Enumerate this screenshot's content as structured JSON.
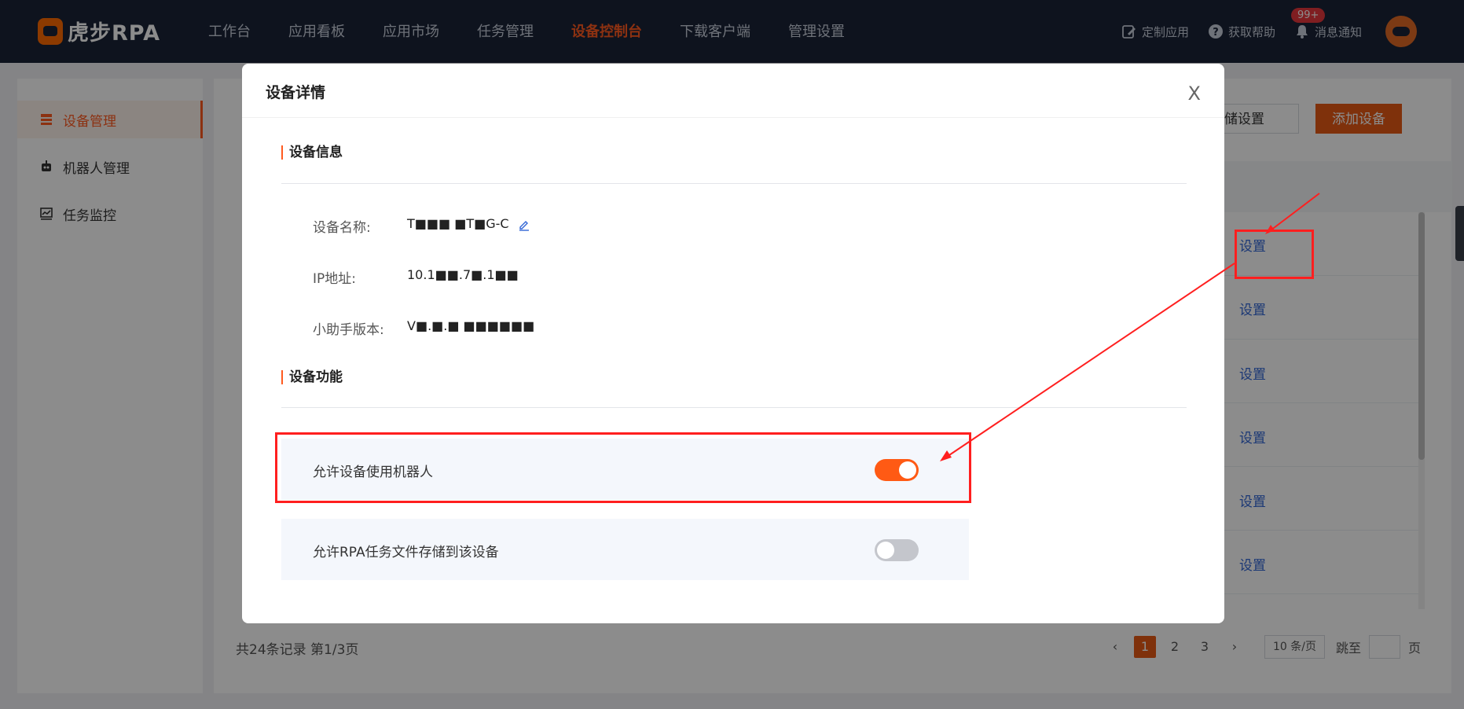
{
  "brand": {
    "name": "虎步RPA"
  },
  "nav": {
    "items": [
      "工作台",
      "应用看板",
      "应用市场",
      "任务管理",
      "设备控制台",
      "下载客户端",
      "管理设置"
    ],
    "active": "设备控制台"
  },
  "tools": {
    "custom_app": "定制应用",
    "help": "获取帮助",
    "notify": "消息通知",
    "notify_badge": "99+"
  },
  "sidebar": {
    "items": [
      {
        "label": "设备管理",
        "icon": "device-list-icon",
        "active": true
      },
      {
        "label": "机器人管理",
        "icon": "robot-icon",
        "active": false
      },
      {
        "label": "任务监控",
        "icon": "monitor-chart-icon",
        "active": false
      }
    ]
  },
  "main": {
    "storage_button": "件存储设置",
    "add_button": "添加设备",
    "row_action": "设置",
    "row_count": 6
  },
  "pagination": {
    "total_text": "共24条记录 第1/3页",
    "pages": [
      "1",
      "2",
      "3"
    ],
    "current": "1",
    "page_size": "10 条/页",
    "jump_label": "跳至",
    "page_unit": "页"
  },
  "modal": {
    "title": "设备详情",
    "close": "X",
    "info_section": "设备信息",
    "fields": [
      {
        "label": "设备名称:",
        "value": "T■■■ ■T■G-C"
      },
      {
        "label": "IP地址:",
        "value": "10.1■■.7■.1■■"
      },
      {
        "label": "小助手版本:",
        "value": "V■.■.■ ■■■■■■"
      }
    ],
    "feature_section": "设备功能",
    "features": [
      {
        "label": "允许设备使用机器人",
        "enabled": true
      },
      {
        "label": "允许RPA任务文件存储到该设备",
        "enabled": false
      }
    ]
  },
  "colors": {
    "accent": "#ff5a14",
    "nav_bg": "#1b2437",
    "link": "#3266d6",
    "annotation": "#ff1f1f"
  }
}
